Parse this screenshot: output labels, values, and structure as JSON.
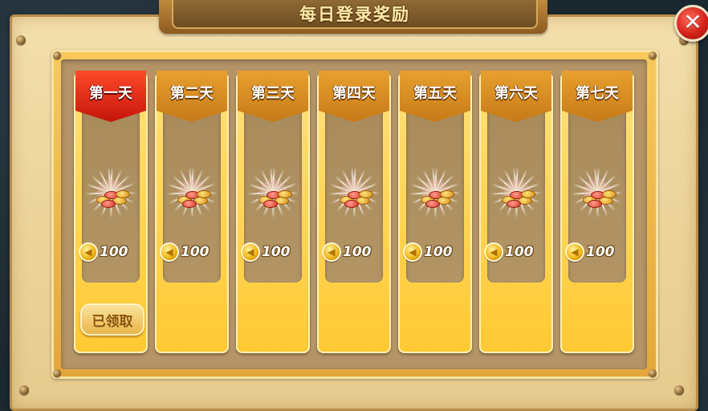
{
  "dialog": {
    "title": "每日登录奖励",
    "close_icon": "close-x-icon"
  },
  "colors": {
    "active_ribbon": "#d6230f",
    "ribbon": "#d98a22",
    "card": "#ffcc3a",
    "parchment": "#efd8a2"
  },
  "days": [
    {
      "label": "第一天",
      "reward": "100",
      "active": true,
      "status": "已领取"
    },
    {
      "label": "第二天",
      "reward": "100",
      "active": false
    },
    {
      "label": "第三天",
      "reward": "100",
      "active": false
    },
    {
      "label": "第四天",
      "reward": "100",
      "active": false
    },
    {
      "label": "第五天",
      "reward": "100",
      "active": false
    },
    {
      "label": "第六天",
      "reward": "100",
      "active": false
    },
    {
      "label": "第七天",
      "reward": "100",
      "active": false
    }
  ]
}
